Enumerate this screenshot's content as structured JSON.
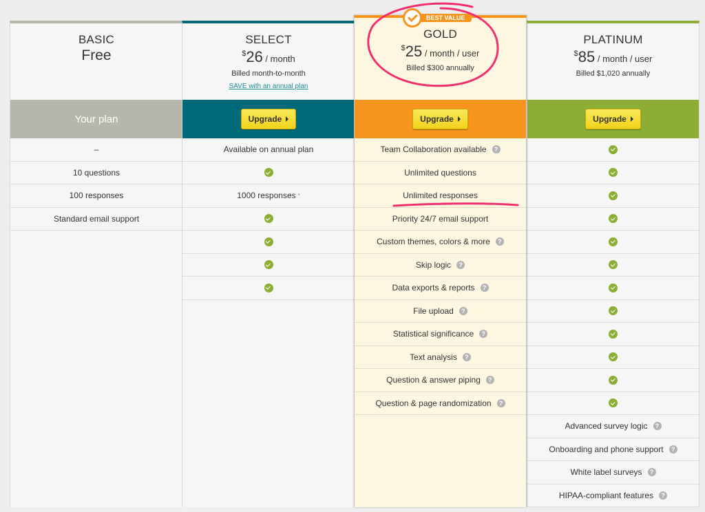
{
  "plans": [
    {
      "name": "BASIC",
      "price_text": "Free",
      "action_label": "Your plan",
      "color": "#b6b7aa",
      "features": [
        {
          "text": "–"
        },
        {
          "text": "10 questions"
        },
        {
          "text": "100 responses"
        },
        {
          "text": "Standard email support"
        }
      ]
    },
    {
      "name": "SELECT",
      "currency": "$",
      "amount": "26",
      "period": " / month",
      "billed": "Billed month-to-month",
      "save_link": "SAVE with an annual plan",
      "action_label": "Upgrade",
      "color": "#006a78",
      "features": [
        {
          "text": "Available on annual plan"
        },
        {
          "check": true
        },
        {
          "text": "1000 responses",
          "asterisk": "*"
        },
        {
          "check": true
        },
        {
          "check": true
        },
        {
          "check": true
        },
        {
          "check": true
        }
      ]
    },
    {
      "name": "GOLD",
      "badge": "BEST VALUE",
      "currency": "$",
      "amount": "25",
      "period": " / month / user",
      "billed": "Billed $300 annually",
      "action_label": "Upgrade",
      "color": "#f7941d",
      "features": [
        {
          "text": "Team Collaboration available",
          "help": true
        },
        {
          "text": "Unlimited questions"
        },
        {
          "text": "Unlimited responses"
        },
        {
          "text": "Priority 24/7 email support"
        },
        {
          "text": "Custom themes, colors & more",
          "help": true
        },
        {
          "text": "Skip logic",
          "help": true
        },
        {
          "text": "Data exports & reports",
          "help": true
        },
        {
          "text": "File upload",
          "help": true
        },
        {
          "text": "Statistical significance",
          "help": true
        },
        {
          "text": "Text analysis",
          "help": true
        },
        {
          "text": "Question & answer piping",
          "help": true
        },
        {
          "text": "Question & page randomization",
          "help": true
        }
      ]
    },
    {
      "name": "PLATINUM",
      "currency": "$",
      "amount": "85",
      "period": " / month / user",
      "billed": "Billed $1,020 annually",
      "action_label": "Upgrade",
      "color": "#8cae35",
      "features": [
        {
          "check": true
        },
        {
          "check": true
        },
        {
          "check": true
        },
        {
          "check": true
        },
        {
          "check": true
        },
        {
          "check": true
        },
        {
          "check": true
        },
        {
          "check": true
        },
        {
          "check": true
        },
        {
          "check": true
        },
        {
          "check": true
        },
        {
          "check": true
        },
        {
          "text": "Advanced survey logic",
          "help": true
        },
        {
          "text": "Onboarding and phone support",
          "help": true
        },
        {
          "text": "White label surveys",
          "help": true
        },
        {
          "text": "HIPAA-compliant features",
          "help": true
        }
      ]
    }
  ],
  "help_glyph": "?",
  "annotation_color": "#f0306e"
}
